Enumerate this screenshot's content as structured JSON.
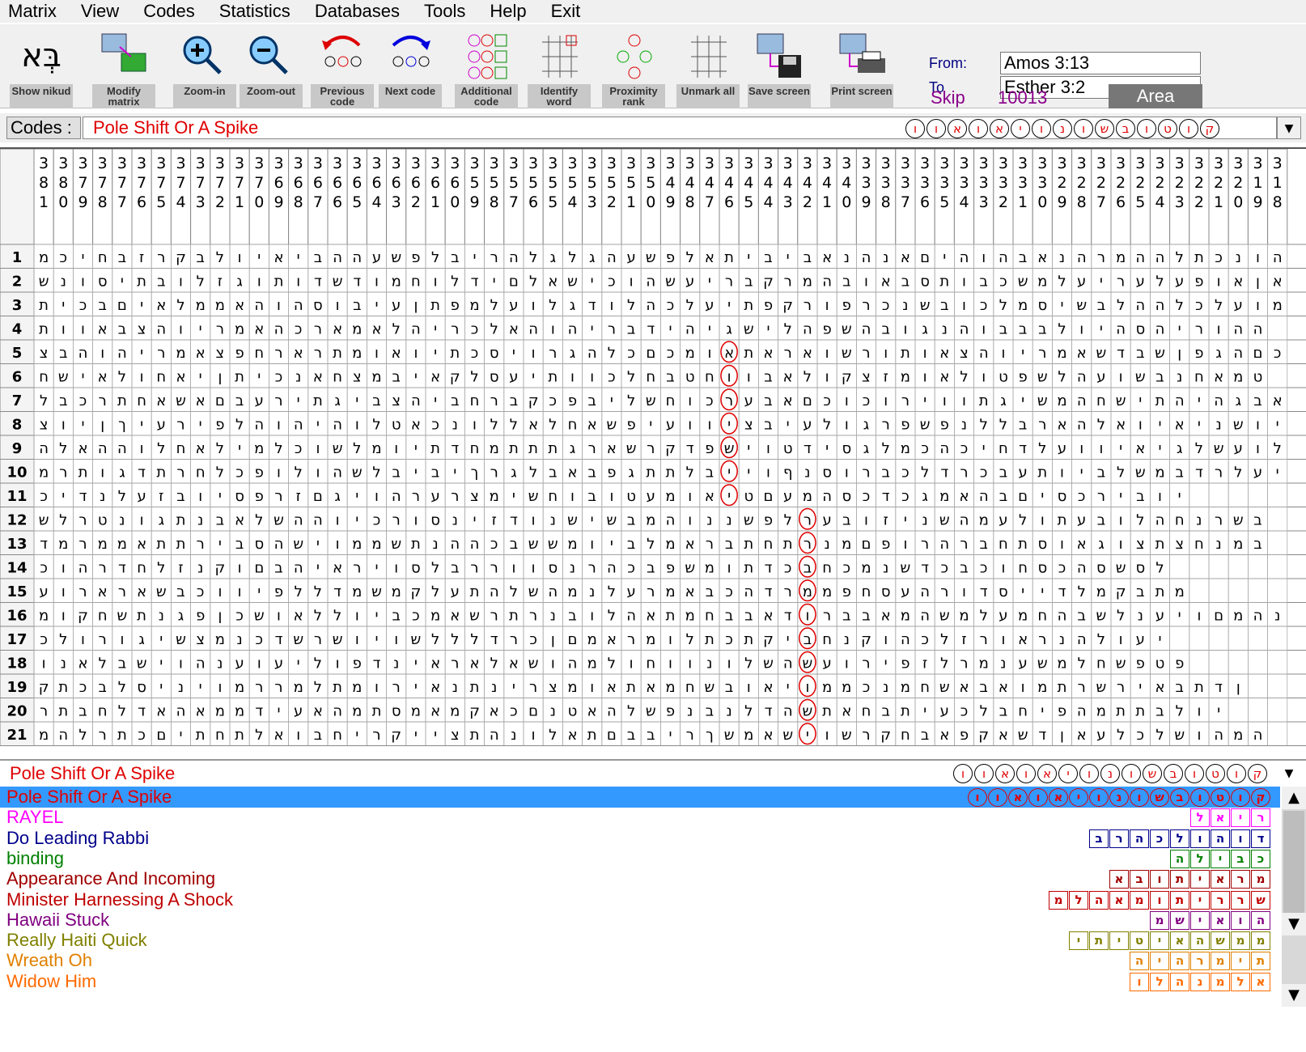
{
  "menu": [
    "Matrix",
    "View",
    "Codes",
    "Statistics",
    "Databases",
    "Tools",
    "Help",
    "Exit"
  ],
  "toolbar": {
    "buttons": [
      {
        "label": "Show nikud",
        "icon": "hebrew-nikud-icon"
      },
      {
        "label": "Modify matrix",
        "icon": "matrix-grid-icon"
      },
      {
        "label": "Zoom-in",
        "icon": "zoom-in-icon"
      },
      {
        "label": "Zoom-out",
        "icon": "zoom-out-icon"
      },
      {
        "label": "Previous code",
        "icon": "previous-arrow-icon"
      },
      {
        "label": "Next code",
        "icon": "next-arrow-icon"
      },
      {
        "label": "Additional code",
        "icon": "letter-grid-icon"
      },
      {
        "label": "Identify word",
        "icon": "identify-word-icon"
      },
      {
        "label": "Proximity rank",
        "icon": "proximity-grid-icon"
      },
      {
        "label": "Unmark all",
        "icon": "unmark-icon"
      },
      {
        "label": "Save screen",
        "icon": "save-disk-icon"
      },
      {
        "label": "Print screen",
        "icon": "printer-icon"
      }
    ],
    "from_label": "From:",
    "from_value": "Amos 3:13",
    "to_label": "To",
    "to_value": "Esther 3:2",
    "skip_label": "Skip",
    "skip_value": "10013",
    "area_label": "Area"
  },
  "codes": {
    "label": "Codes :",
    "value": "Pole Shift Or A Spike",
    "hebrew": [
      "ק",
      "ו",
      "ט",
      "ו",
      "ב",
      "ש",
      "ו",
      "נ",
      "ו",
      "י",
      "א",
      "ו",
      "א",
      "ו",
      "ו"
    ],
    "dropdown_icon": "chevron-down-icon"
  },
  "matrix": {
    "columns": [
      "381",
      "380",
      "379",
      "378",
      "377",
      "376",
      "375",
      "374",
      "373",
      "372",
      "371",
      "370",
      "369",
      "368",
      "367",
      "366",
      "365",
      "364",
      "363",
      "362",
      "361",
      "360",
      "359",
      "358",
      "357",
      "356",
      "355",
      "354",
      "353",
      "352",
      "351",
      "350",
      "349",
      "348",
      "347",
      "346",
      "345",
      "344",
      "343",
      "342",
      "341",
      "340",
      "339",
      "338",
      "337",
      "336",
      "335",
      "334",
      "333",
      "332",
      "331",
      "330",
      "329",
      "328",
      "327",
      "326",
      "325",
      "324",
      "323",
      "322",
      "321",
      "320",
      "319",
      "318"
    ],
    "rows": [
      "1",
      "2",
      "3",
      "4",
      "5",
      "6",
      "7",
      "8",
      "9",
      "10",
      "11",
      "12",
      "13",
      "14",
      "15",
      "16",
      "17",
      "18",
      "19",
      "20",
      "21"
    ],
    "cells": [
      "מכיחבזרקבלויאיבההעשפלבירהלגלגהעשפלאתיביבאנהנאםיהוהבאנהרמההלתכנוהלשה",
      "שנוסיתבולזגותודשדומחולדיםלאשיכוהשעירבקרמהבואבסתובכשמלעירעלעפואןא",
      "תיכבםיאלממאהוהסוביעןתפמלעולגדולהכלעיתפקרופרכנשבוכלמסישבלההלכלעומדמ",
      "תוואבצהוירמאהכראמאלהירכלאהוהירבדיהיגשילהפשהבוגנהובבבלויהסהירוהה",
      "צבהוהירמאצפחרארתמואויתכסיורגהלכםכמואתאראושרותואצהוירמאשדבשןפגהםכלל",
      "חשיאלוחאיןתיכנאחצמביאקלסעיתווכלחבטחוובאלוקצזמואלוטפשלהעושבנחאמט",
      "לבכרתחאשאםבעריתגיבצהיבחרבקכפבילשחוכרעבאםכוכוריוותגישמהחשיתהיהגבאולמבדנגלנ",
      "צויןךיעריפלהוהיהולטאכנוללאלחאשפיעוויצביעלוגרפשפנללבראהלאויאינשויםמיל",
      "הלאההולחאלימלכושלמויתדחמתתתגראשרקדפשיוטדיסגלמכהכיחדלעוויאיגלשעולשואלכאה",
      "מרתוגדתרחלכפולוהשלביביךרגלבאבפגתתלבייוףנסורבכלדרכבעתויבלשמבדרלעיויקאיוורבי",
      "כידנלעזבויספרזםגיוהרערצמישחובוטעמואיטםעמ הסכדכגמאהבםיסכריבוי",
      "שלרטנוגתנבאלשההויכרוסניזדונשישבמהוננשפלרעבוזינשהמעלותעבולהחנרשב",
      "דמרממאתתריבסהשיוממשתנההכבששמויבלמארבתחתרנמםפורהרבחתסואגוצתצחנמב",
      "כוהרדחלזנקוםבהיאריוסלבררווסנרהכבפשמותדכבחכמנשדכבכוחסכהסשסל",
      "עוראראשבכוויפללדמשמקלעתהלשהמנלערמאבכהדרממפחסעהרודסיידלמקבתמ",
      "מוקחשתנגפןכשואללויבכמאשרתרנבולהאתמחבבאדורבבאמהשמלעמחהבשלנעיוםמהנוקבס",
      "כלורוגישצמנכדשרשויושלללדרכןםמארמולתכתקיבחנקוהכלזרוארנהלועי",
      "ונאלבשיוהנעועילופדניאראלאשוהמלוחוונולשהשעוריפזלרמנעשמלחשפטפ",
      "קתכבלסיניומררמלתמוריאנתנירצמואתאמחשבואיוממכנמחשאבאומתרשריאבתדן",
      "רתבחלדאהאממדיעאהמתסמאמקאכםנטאהלשפנבנלדהשתאחבתיעכלבחיפהמתתבלוי",
      "מהלרתכםיתחתלאובחירקייצתהנולאתםבבירךשמאשיושרקחבאפקאשדןאעלכלשוהמה"
    ],
    "highlight_color": "#e00000"
  },
  "results": {
    "header_title": "Pole Shift Or A Spike",
    "header_hebrew": [
      "ק",
      "ו",
      "ט",
      "ו",
      "ב",
      "ש",
      "ו",
      "נ",
      "ו",
      "י",
      "א",
      "ו",
      "א",
      "ו",
      "ו"
    ],
    "items": [
      {
        "text": "Pole Shift Or A Spike",
        "color": "#e00000",
        "hebrew": [
          "ק",
          "ו",
          "ט",
          "ו",
          "ב",
          "ש",
          "ו",
          "נ",
          "ו",
          "י",
          "א",
          "ו",
          "א",
          "ו",
          "ו"
        ],
        "selected": true
      },
      {
        "text": "RAYEL",
        "color": "#ff00ff",
        "hebrew": [
          "ר",
          "י",
          "א",
          "ל"
        ]
      },
      {
        "text": "Do Leading Rabbi",
        "color": "#00008b",
        "hebrew": [
          "ד",
          "ו",
          "ה",
          "ו",
          "ל",
          "כ",
          "ה",
          "ר",
          "ב"
        ]
      },
      {
        "text": "binding",
        "color": "#008000",
        "hebrew": [
          "כ",
          "ב",
          "י",
          "ל",
          "ה"
        ]
      },
      {
        "text": "Appearance And Incoming",
        "color": "#a00000",
        "hebrew": [
          "מ",
          "ר",
          "א",
          "י",
          "ת",
          "ו",
          "ב",
          "א"
        ]
      },
      {
        "text": "Minister Harnessing A Shock",
        "color": "#c00000",
        "hebrew": [
          "ש",
          "ר",
          "ר",
          "י",
          "ת",
          "ו",
          "מ",
          "א",
          "ה",
          "ל",
          "מ"
        ]
      },
      {
        "text": "Hawaii Stuck",
        "color": "#800080",
        "hebrew": [
          "ה",
          "ו",
          "א",
          "י",
          "ש",
          "מ"
        ]
      },
      {
        "text": "Really Haiti Quick",
        "color": "#808000",
        "hebrew": [
          "מ",
          "מ",
          "ש",
          "ה",
          "א",
          "י",
          "ט",
          "י",
          "ת",
          "י"
        ]
      },
      {
        "text": "Wreath Oh",
        "color": "#e08000",
        "hebrew": [
          "ת",
          "י",
          "מ",
          "ר",
          "ה",
          "י",
          "ה"
        ]
      },
      {
        "text": "Widow Him",
        "color": "#ff6a00",
        "hebrew": [
          "א",
          "ל",
          "מ",
          "נ",
          "ה",
          "ל",
          "ו"
        ]
      }
    ]
  }
}
